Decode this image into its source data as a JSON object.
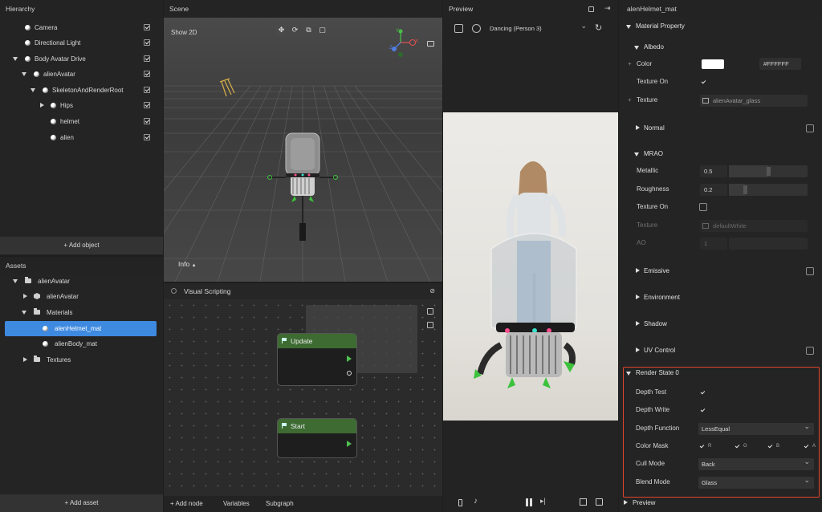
{
  "hierarchy": {
    "title": "Hierarchy",
    "items": [
      {
        "label": "Camera"
      },
      {
        "label": "Directional Light"
      },
      {
        "label": "Body Avatar Drive"
      },
      {
        "label": "alienAvatar"
      },
      {
        "label": "SkeletonAndRenderRoot"
      },
      {
        "label": "Hips"
      },
      {
        "label": "helmet"
      },
      {
        "label": "alien"
      }
    ],
    "add_label": "+ Add object"
  },
  "assets": {
    "title": "Assets",
    "items": [
      {
        "label": "alienAvatar"
      },
      {
        "label": "alienAvatar"
      },
      {
        "label": "Materials"
      },
      {
        "label": "alenHelmet_mat"
      },
      {
        "label": "alienBody_mat"
      },
      {
        "label": "Textures"
      }
    ],
    "add_label": "+ Add asset"
  },
  "scene": {
    "title": "Scene",
    "show2d": "Show 2D",
    "info": "Info",
    "gizmo_y": "Y",
    "gizmo_x": "X",
    "gizmo_z": "Z"
  },
  "visual_scripting": {
    "title": "Visual Scripting",
    "nodes": [
      {
        "label": "Update"
      },
      {
        "label": "Start"
      }
    ],
    "footer": {
      "add_node": "+ Add node",
      "variables": "Variables",
      "subgraph": "Subgraph"
    }
  },
  "preview": {
    "title": "Preview",
    "animation": "Dancing (Person 3)"
  },
  "inspector": {
    "title": "alenHelmet_mat",
    "material_property": "Material Property",
    "albedo": {
      "label": "Albedo",
      "color_label": "Color",
      "color_hex": "#FFFFFF",
      "texture_on_label": "Texture On",
      "texture_label": "Texture",
      "texture_value": "alienAvatar_glass"
    },
    "normal": "Normal",
    "mrao": {
      "label": "MRAO",
      "metallic_label": "Metallic",
      "metallic_value": "0.5",
      "roughness_label": "Roughness",
      "roughness_value": "0.2",
      "texture_on_label": "Texture On",
      "texture_label": "Texture",
      "texture_value": "defaultWhite",
      "ao_label": "AO",
      "ao_value": "1"
    },
    "emissive": "Emissive",
    "environment": "Environment",
    "shadow": "Shadow",
    "uv_control": "UV Control",
    "render_state": {
      "label": "Render State 0",
      "depth_test": "Depth Test",
      "depth_write": "Depth Write",
      "depth_function_label": "Depth Function",
      "depth_function_value": "LessEqual",
      "color_mask_label": "Color Mask",
      "mask_r": "R",
      "mask_g": "G",
      "mask_b": "B",
      "mask_a": "A",
      "cull_mode_label": "Cull Mode",
      "cull_mode_value": "Back",
      "blend_mode_label": "Blend Mode",
      "blend_mode_value": "Glass"
    },
    "preview_section": "Preview"
  },
  "colors": {
    "accent": "#3e8ae0",
    "highlight_box": "#e0442a",
    "node_header": "#3d6b32"
  }
}
